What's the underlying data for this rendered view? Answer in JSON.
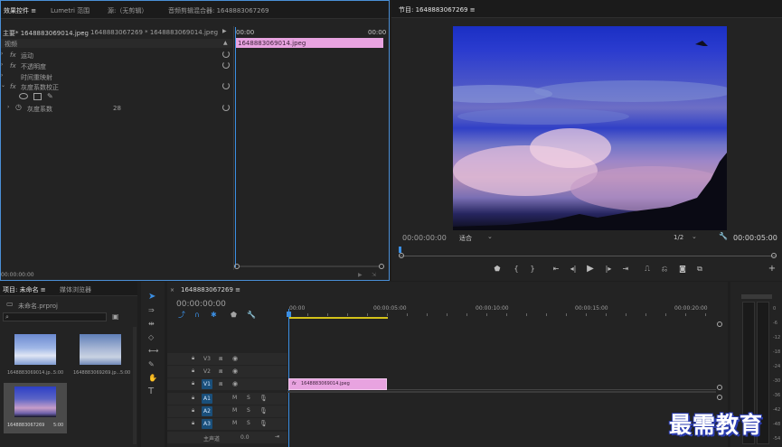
{
  "effect_controls": {
    "tabs": [
      "效果控件 ≡",
      "Lumetri 范围",
      "源:（无剪辑）",
      "音频剪辑混合器: 1648883067269"
    ],
    "clip_master": "主要* 1648883069014.jpeg",
    "clip_sequence": "1648883067269 * 1648883069014.jpeg",
    "time_start": "00:00",
    "time_end": "00:00",
    "clip_bar_label": "1648883069014.jpeg",
    "section_video": "视频",
    "effects": [
      {
        "fx": "fx",
        "name": "运动"
      },
      {
        "fx": "fx",
        "name": "不透明度"
      },
      {
        "fx": "",
        "name": "时间重映射"
      },
      {
        "fx": "fx",
        "name": "灰度系数校正"
      }
    ],
    "param_name": "灰度系数",
    "param_value": "28",
    "bottom_timecode": "00:00:00:00"
  },
  "program": {
    "title": "节目: 1648883067269 ≡",
    "timecode": "00:00:00:00",
    "fit_label": "适合",
    "resolution": "1/2",
    "duration": "00:00:05:00"
  },
  "project": {
    "tabs": [
      "项目: 未命名 ≡",
      "媒体浏览器"
    ],
    "project_file": "未命名.prproj",
    "items": [
      {
        "name": "1648883069014.jp...",
        "duration": "5:00"
      },
      {
        "name": "1648883069269.jp...",
        "duration": "5:00"
      },
      {
        "name": "1648883067269",
        "duration": "5:00"
      }
    ]
  },
  "timeline": {
    "title": "1648883067269 ≡",
    "timecode": "00:00:00:00",
    "ruler": [
      "00:00",
      "00:00:05:00",
      "00:00:10:00",
      "00:00:15:00",
      "00:00:20:00"
    ],
    "tracks": [
      "V3",
      "V2",
      "V1",
      "A1",
      "A2",
      "A3"
    ],
    "master_label": "主声道",
    "master_value": "0.0",
    "clip_label": "1648883069014.jpeg",
    "clip_fx": "fx"
  },
  "meter_scale": [
    "0",
    "-6",
    "-12",
    "-18",
    "-24",
    "-30",
    "-36",
    "-42",
    "-48",
    "-54"
  ],
  "watermark": "最需教育",
  "colors": {
    "accent": "#2d8ceb",
    "clip": "#e8a3e0",
    "playhead": "#3b8fe4",
    "work_area": "#d4c21a"
  }
}
